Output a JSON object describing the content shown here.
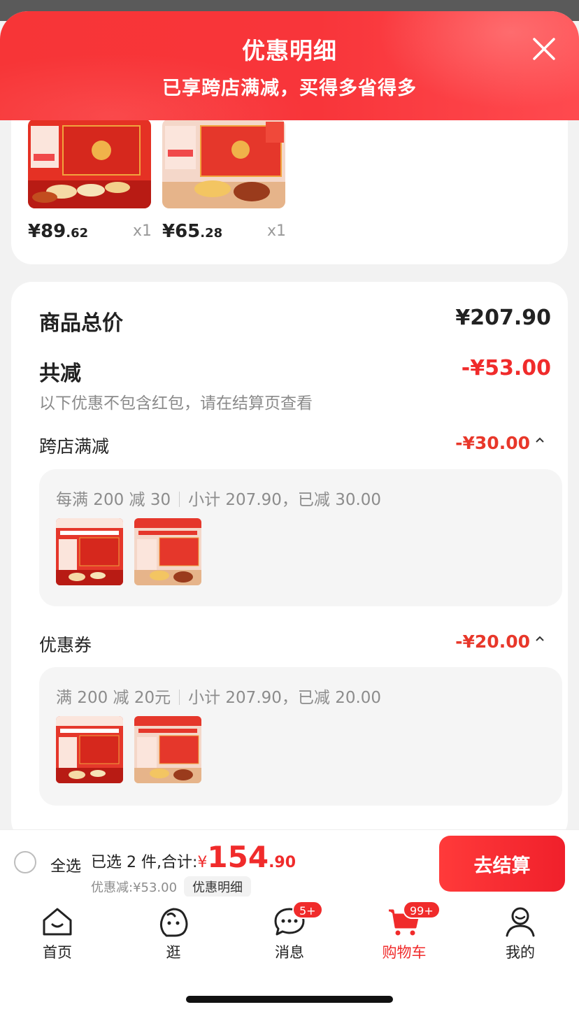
{
  "header": {
    "title": "优惠明细",
    "subtitle": "已享跨店满减，买得多省得多"
  },
  "top_products": [
    {
      "price_int": "¥89",
      "price_dec": ".62",
      "qty": "x1"
    },
    {
      "price_int": "¥65",
      "price_dec": ".28",
      "qty": "x1"
    }
  ],
  "summary": {
    "total_label": "商品总价",
    "total_value": "¥207.90",
    "reduce_label": "共减",
    "reduce_value": "-¥53.00",
    "note": "以下优惠不包含红包，请在结算页查看"
  },
  "sections": [
    {
      "label": "跨店满减",
      "value": "-¥30.00",
      "rule": "每满 200 减 30",
      "detail": "小计 207.90，已减 30.00"
    },
    {
      "label": "优惠券",
      "value": "-¥20.00",
      "rule": "满 200 减 20元",
      "detail": "小计 207.90，已减 20.00"
    }
  ],
  "checkout": {
    "select_all": "全选",
    "selected_text": "已选 2 件,合计:",
    "currency": "¥",
    "total_int": "154",
    "total_dec": ".90",
    "discount_text": "优惠减:¥53.00",
    "detail_chip": "优惠明细",
    "button": "去结算"
  },
  "tabs": [
    {
      "label": "首页",
      "icon": "home-icon"
    },
    {
      "label": "逛",
      "icon": "browse-icon"
    },
    {
      "label": "消息",
      "icon": "message-icon",
      "badge": "5+"
    },
    {
      "label": "购物车",
      "icon": "cart-icon",
      "badge": "99+"
    },
    {
      "label": "我的",
      "icon": "profile-icon"
    }
  ],
  "colors": {
    "accent": "#f02b2b",
    "banner": "#f73537"
  }
}
